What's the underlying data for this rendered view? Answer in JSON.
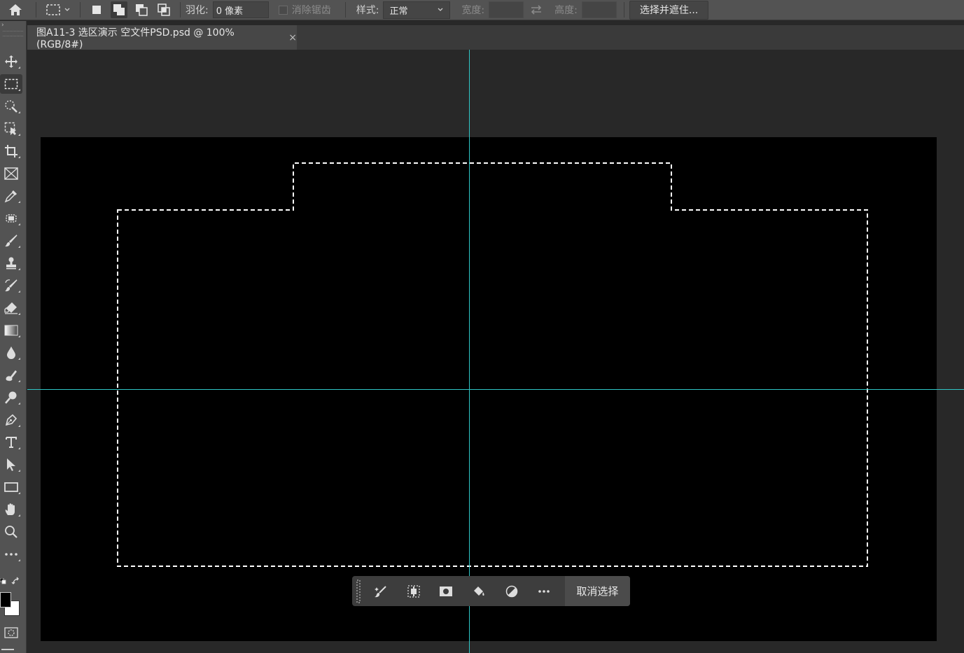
{
  "options_bar": {
    "feather_label": "羽化:",
    "feather_value": "0 像素",
    "antialias_label": "消除锯齿",
    "style_label": "样式:",
    "style_value": "正常",
    "width_label": "宽度:",
    "height_label": "高度:",
    "refine_button": "选择并遮住..."
  },
  "tab": {
    "title": "图A11-3 选区演示 空文件PSD.psd @ 100%(RGB/8#)",
    "close": "×"
  },
  "toolbar": {
    "tools": [
      "home-icon",
      "move-icon",
      "rectangular-marquee-icon",
      "quick-selection-icon",
      "object-selection-icon",
      "crop-icon",
      "frame-icon",
      "eyedropper-icon",
      "spot-healing-icon",
      "brush-icon",
      "clone-stamp-icon",
      "history-brush-icon",
      "eraser-icon",
      "gradient-icon",
      "blur-icon",
      "dodge-icon",
      "pen-icon",
      "type-icon",
      "path-selection-icon",
      "rectangle-icon",
      "hand-icon",
      "zoom-icon",
      "more-tools-icon"
    ]
  },
  "contextual_taskbar": {
    "deselect_label": "取消选择"
  },
  "colors": {
    "guide": "#2fc6c6",
    "canvas": "#000000",
    "panel": "#535353"
  }
}
